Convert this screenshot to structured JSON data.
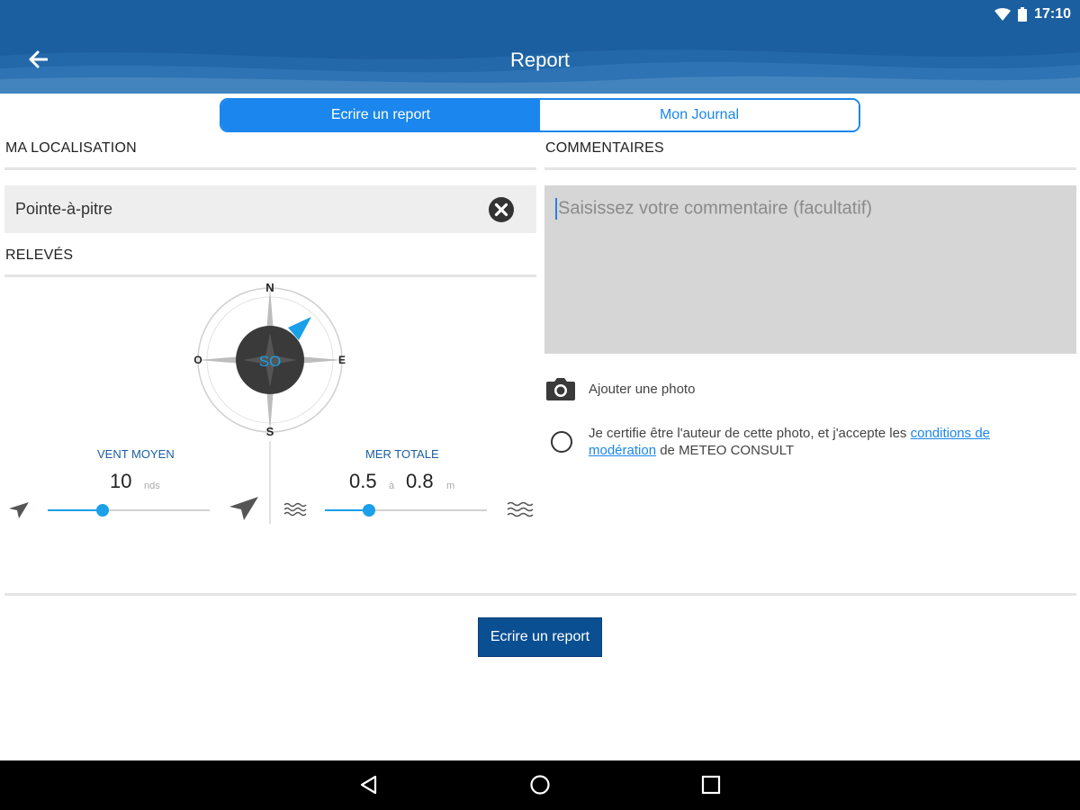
{
  "status": {
    "time": "17:10"
  },
  "header": {
    "title": "Report"
  },
  "tabs": [
    {
      "label": "Ecrire un report",
      "active": true
    },
    {
      "label": "Mon Journal",
      "active": false
    }
  ],
  "location": {
    "section_label": "MA LOCALISATION",
    "value": "Pointe-à-pitre"
  },
  "readings": {
    "section_label": "RELEVÉS",
    "compass": {
      "north": "N",
      "east": "E",
      "south": "S",
      "west": "O",
      "direction": "SO"
    },
    "wind": {
      "label": "VENT MOYEN",
      "value": "10",
      "unit": "nds",
      "level": 0.34
    },
    "sea": {
      "label": "MER TOTALE",
      "min": "0.5",
      "separator": "à",
      "max": "0.8",
      "unit": "m",
      "level": 0.27
    }
  },
  "comments": {
    "section_label": "COMMENTAIRES",
    "placeholder": "Saisissez votre commentaire (facultatif)"
  },
  "photo": {
    "add_label": "Ajouter une photo",
    "certify_prefix": "Je certifie être l'auteur de cette photo, et j'accepte les ",
    "certify_link": "conditions de modération",
    "certify_suffix": " de METEO CONSULT"
  },
  "submit_label": "Ecrire un report",
  "colors": {
    "header": "#1b5fa0",
    "accent": "#1a86ee",
    "button": "#0b4f93",
    "slider": "#1aa0e8"
  }
}
